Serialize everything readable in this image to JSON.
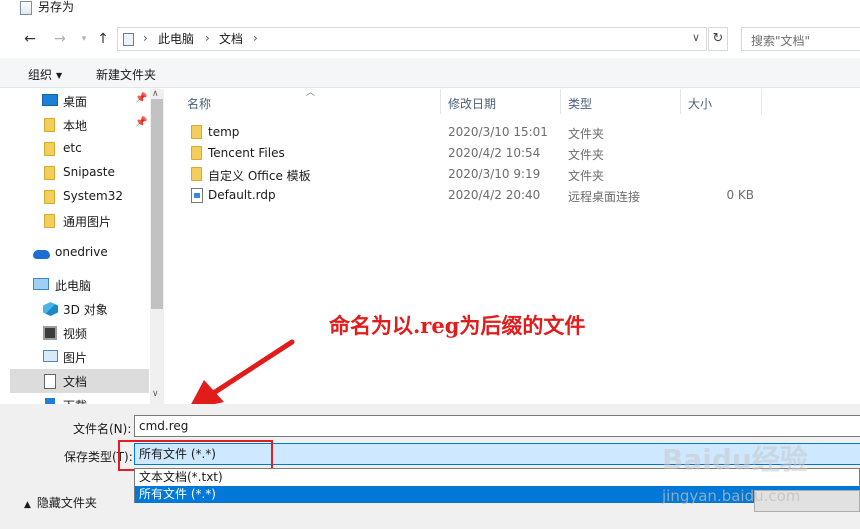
{
  "window": {
    "title": "另存为"
  },
  "nav": {
    "back_icon": "back-arrow-icon",
    "forward_icon": "forward-arrow-icon",
    "up_icon": "up-arrow-icon",
    "path": [
      "此电脑",
      "文档"
    ],
    "search_placeholder": "搜索\"文档\""
  },
  "toolbar": {
    "organize": "组织",
    "new_folder": "新建文件夹"
  },
  "sidebar": {
    "items": [
      {
        "label": "桌面",
        "icon": "desktop-icon",
        "pinned": true
      },
      {
        "label": "本地",
        "icon": "folder-icon",
        "pinned": true
      },
      {
        "label": "etc",
        "icon": "folder-icon"
      },
      {
        "label": "Snipaste",
        "icon": "folder-icon"
      },
      {
        "label": "System32",
        "icon": "folder-icon"
      },
      {
        "label": "通用图片",
        "icon": "folder-icon"
      },
      {
        "label": "onedrive",
        "icon": "onedrive-icon"
      },
      {
        "label": "此电脑",
        "icon": "computer-icon"
      },
      {
        "label": "3D 对象",
        "icon": "3d-objects-icon"
      },
      {
        "label": "视频",
        "icon": "video-icon"
      },
      {
        "label": "图片",
        "icon": "pictures-icon"
      },
      {
        "label": "文档",
        "icon": "documents-icon",
        "selected": true
      },
      {
        "label": "下载",
        "icon": "downloads-icon"
      }
    ]
  },
  "columns": {
    "name": "名称",
    "date": "修改日期",
    "type": "类型",
    "size": "大小"
  },
  "files": [
    {
      "name": "temp",
      "date": "2020/3/10 15:01",
      "type": "文件夹",
      "size": "",
      "icon": "folder-icon"
    },
    {
      "name": "Tencent Files",
      "date": "2020/4/2 10:54",
      "type": "文件夹",
      "size": "",
      "icon": "folder-icon"
    },
    {
      "name": "自定义 Office 模板",
      "date": "2020/3/10 9:19",
      "type": "文件夹",
      "size": "",
      "icon": "folder-icon"
    },
    {
      "name": "Default.rdp",
      "date": "2020/4/2 20:40",
      "type": "远程桌面连接",
      "size": "0 KB",
      "icon": "rdp-file-icon"
    }
  ],
  "annotation": {
    "text": "命名为以.reg为后缀的文件",
    "color": "#e21b1b"
  },
  "form": {
    "filename_label": "文件名(N):",
    "filename_value": "cmd.reg",
    "filetype_label": "保存类型(T):",
    "filetype_value": "所有文件 (*.*)",
    "filetype_options": [
      "文本文档(*.txt)",
      "所有文件 (*.*)"
    ],
    "hide_folders": "隐藏文件夹"
  },
  "watermark": {
    "brand": "Baidu经验",
    "url": "jingyan.baidu.com"
  }
}
